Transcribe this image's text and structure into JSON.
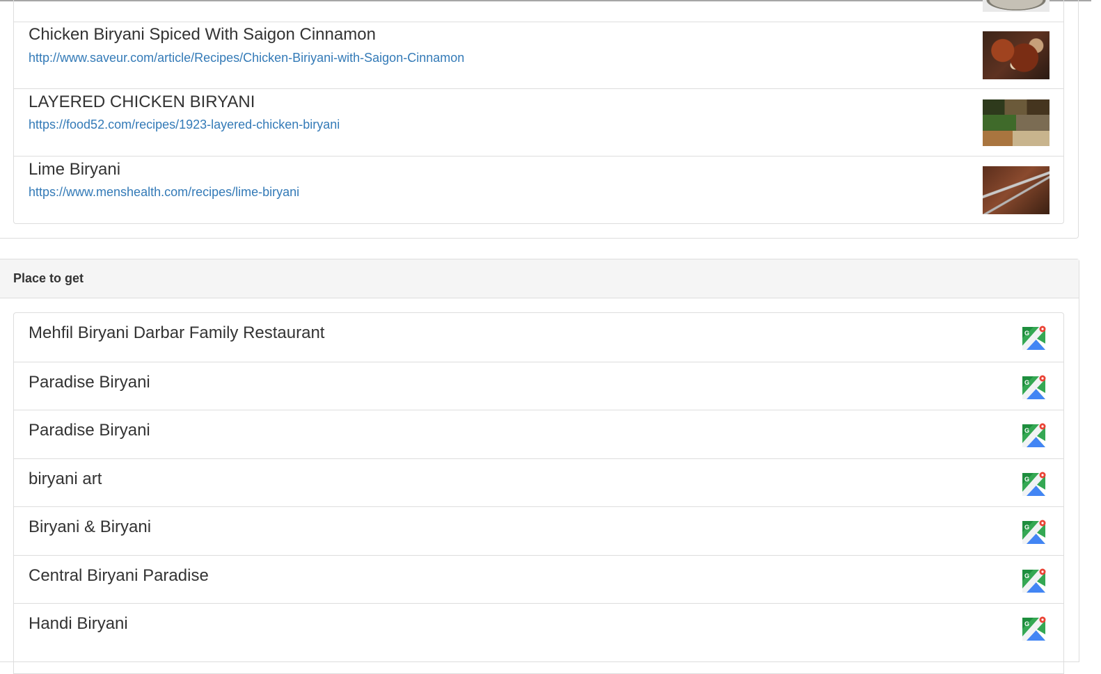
{
  "recipes": [
    {
      "title": "Chicken Biryani Spiced With Saigon Cinnamon",
      "url": "http://www.saveur.com/article/Recipes/Chicken-Biriyani-with-Saigon-Cinnamon"
    },
    {
      "title": "LAYERED CHICKEN BIRYANI",
      "url": "https://food52.com/recipes/1923-layered-chicken-biryani"
    },
    {
      "title": "Lime Biryani",
      "url": "https://www.menshealth.com/recipes/lime-biryani"
    }
  ],
  "places_panel": {
    "heading": "Place to get",
    "places": [
      {
        "name": "Mehfil Biryani Darbar Family Restaurant"
      },
      {
        "name": "Paradise Biryani"
      },
      {
        "name": "Paradise Biryani"
      },
      {
        "name": "biryani art"
      },
      {
        "name": "Biryani & Biryani"
      },
      {
        "name": "Central Biryani Paradise"
      },
      {
        "name": "Handi Biryani"
      }
    ],
    "map_icon": "google-maps-icon"
  },
  "colors": {
    "link": "#337ab7",
    "text": "#333333",
    "border": "#dddddd",
    "heading_bg": "#f5f5f5"
  }
}
